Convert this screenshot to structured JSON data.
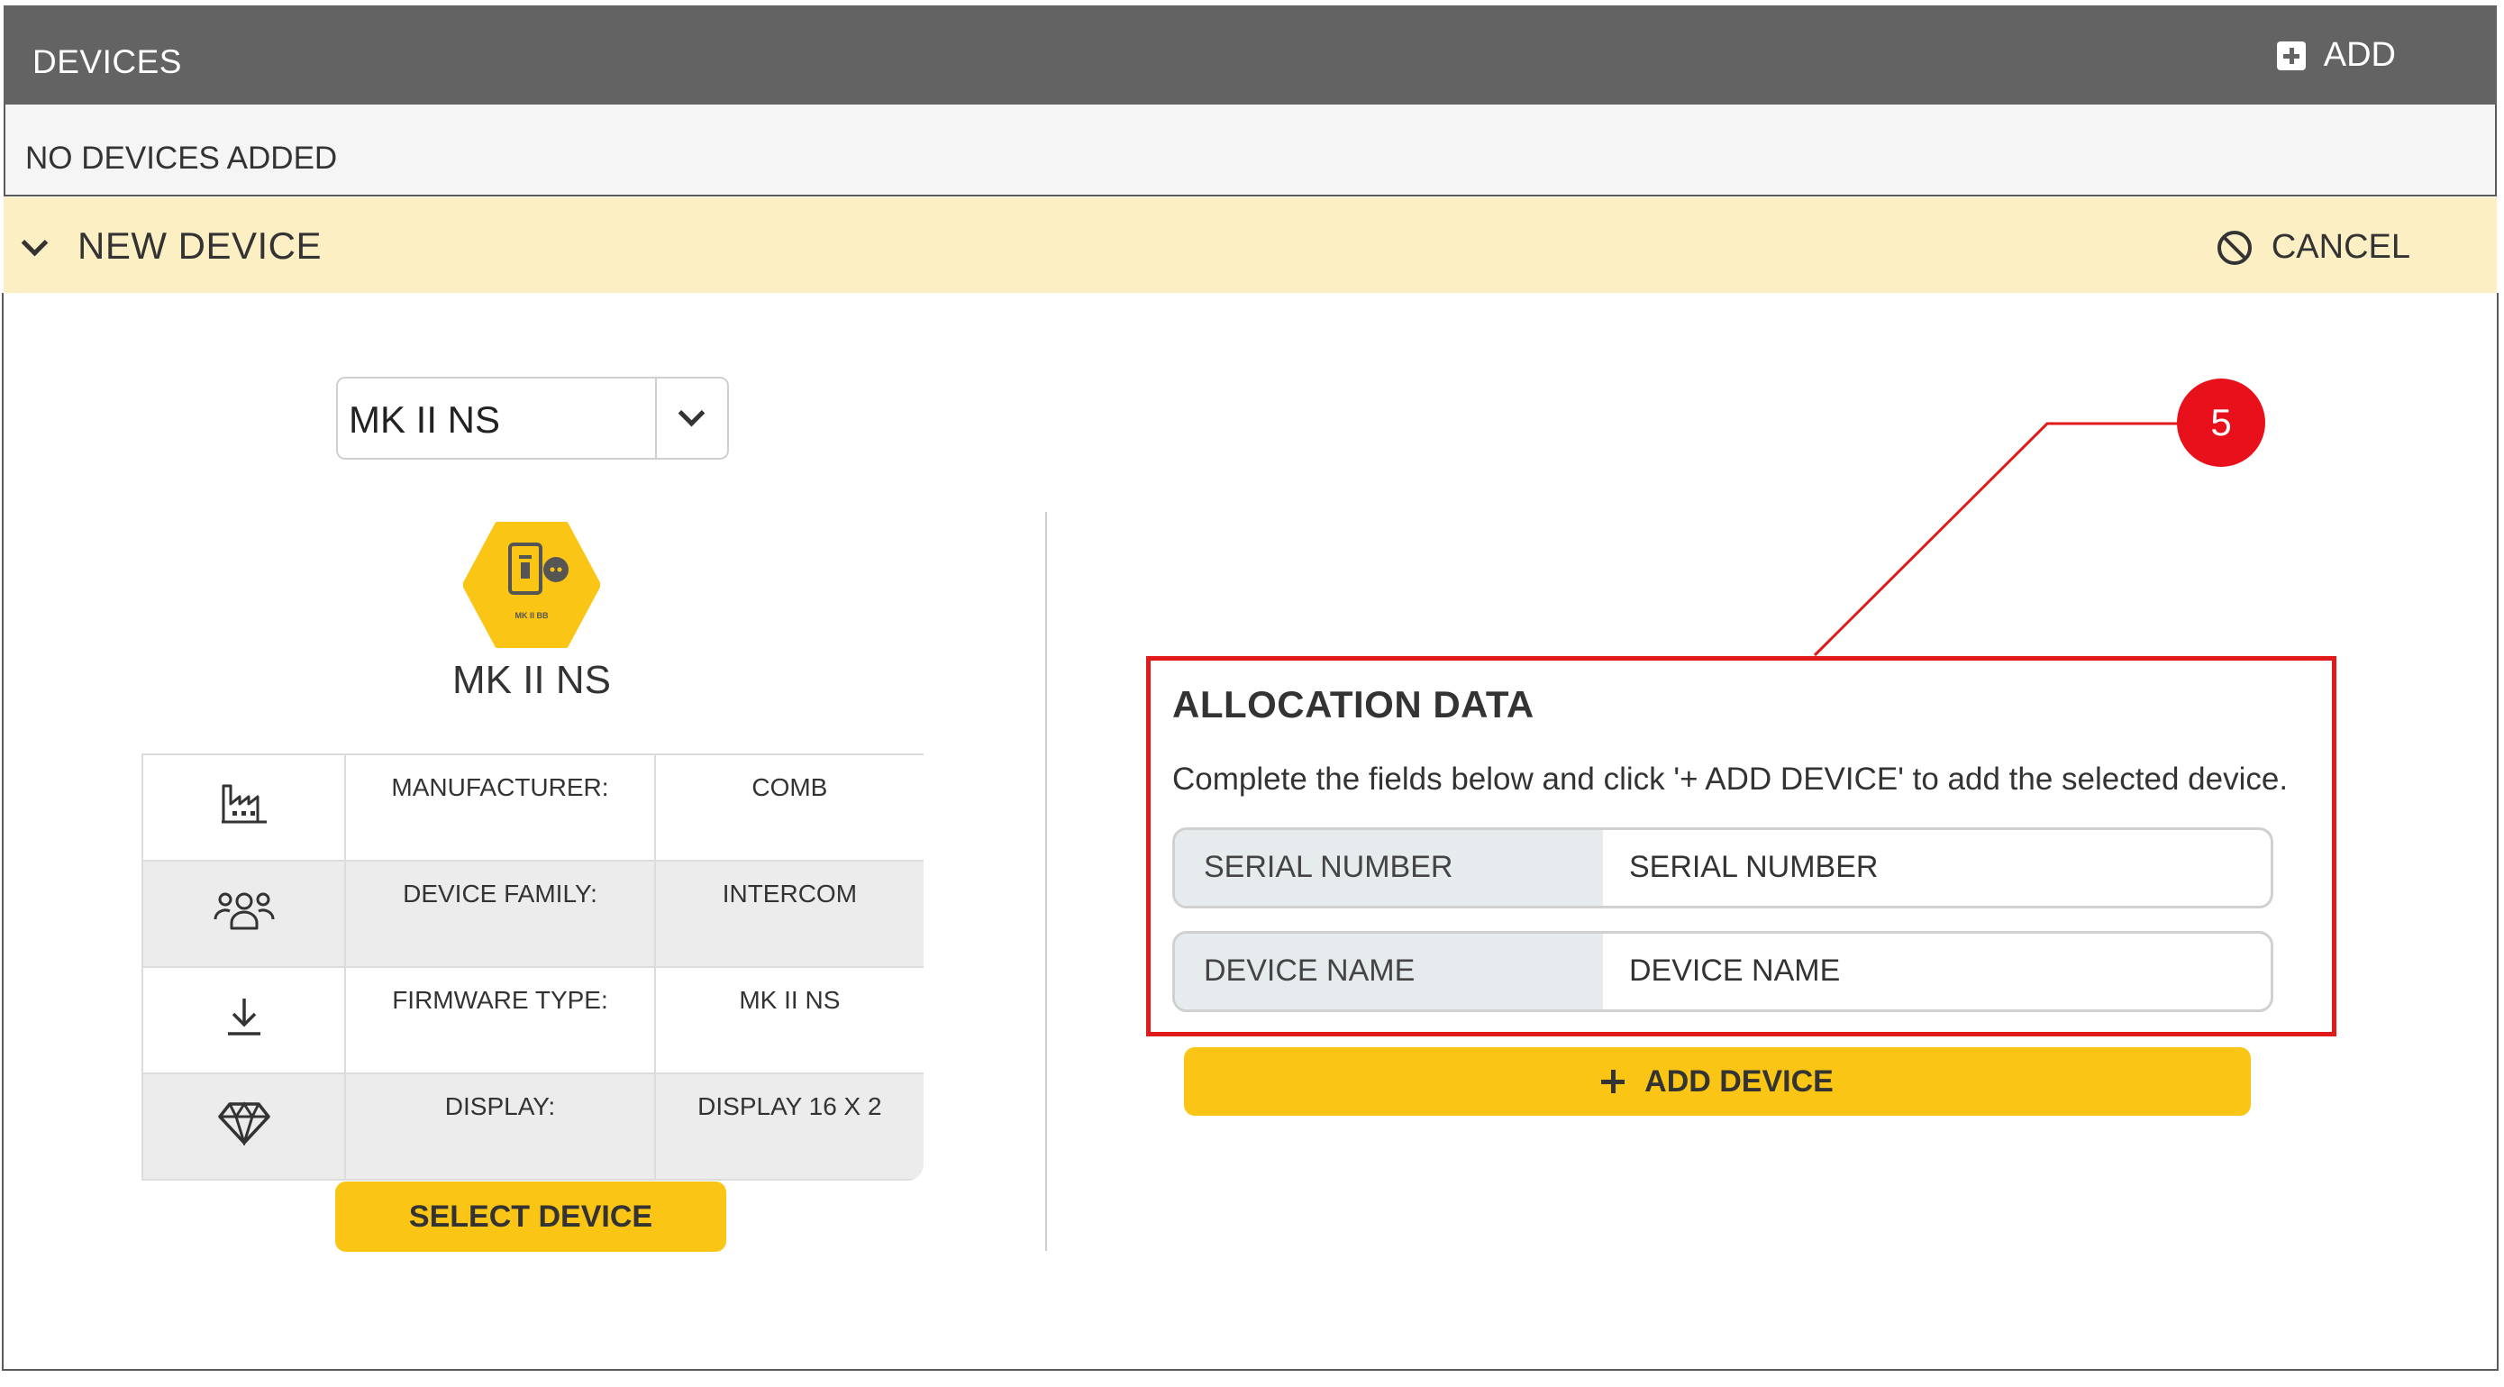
{
  "devices_header": {
    "title": "DEVICES",
    "add_label": "ADD"
  },
  "devices_list": {
    "empty_text": "NO DEVICES ADDED"
  },
  "new_device": {
    "title": "NEW DEVICE",
    "cancel_label": "CANCEL"
  },
  "device_select": {
    "selected": "MK II NS"
  },
  "device_card": {
    "name": "MK II NS",
    "icon_caption": "MK II BB",
    "icon_color": "#fbc516",
    "specs": [
      {
        "icon": "factory-icon",
        "label": "MANUFACTURER:",
        "value": "COMB"
      },
      {
        "icon": "users-icon",
        "label": "DEVICE FAMILY:",
        "value": "INTERCOM"
      },
      {
        "icon": "download-icon",
        "label": "FIRMWARE TYPE:",
        "value": "MK II NS"
      },
      {
        "icon": "diamond-icon",
        "label": "DISPLAY:",
        "value": "DISPLAY 16 X 2"
      }
    ]
  },
  "select_device_label": "SELECT DEVICE",
  "callout": {
    "number": "5",
    "color": "#e8101a"
  },
  "allocation": {
    "title": "ALLOCATION DATA",
    "description": "Complete the fields below and click '+ ADD DEVICE' to add the selected device.",
    "serial": {
      "label": "SERIAL NUMBER",
      "placeholder": "SERIAL NUMBER"
    },
    "name": {
      "label": "DEVICE NAME",
      "placeholder": "DEVICE NAME"
    },
    "add_label": "ADD DEVICE"
  },
  "colors": {
    "header_bg": "#636363",
    "new_device_bg": "#fcefc3",
    "accent_yellow": "#fbc516",
    "highlight_red": "#e01a1a"
  }
}
